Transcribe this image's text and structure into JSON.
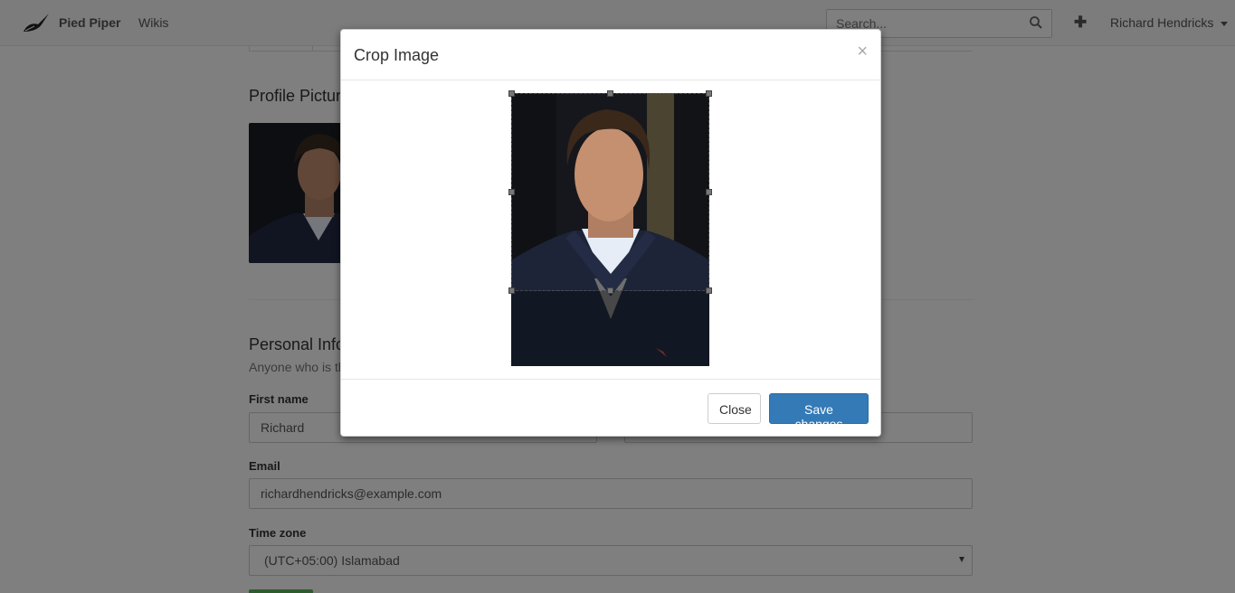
{
  "navbar": {
    "brand": "Pied Piper",
    "wikis": "Wikis",
    "search_placeholder": "Search...",
    "user_name": "Richard Hendricks"
  },
  "profile": {
    "picture_heading": "Profile Picture",
    "personal_heading": "Personal Information",
    "personal_sub": "Anyone who is th"
  },
  "form": {
    "first_name_label": "First name",
    "first_name_value": "Richard",
    "last_name_value": "",
    "email_label": "Email",
    "email_value": "richardhendricks@example.com",
    "timezone_label": "Time zone",
    "timezone_value": "(UTC+05:00) Islamabad"
  },
  "modal": {
    "title": "Crop Image",
    "close_symbol": "×",
    "close_button": "Close",
    "save_button": "Save changes"
  },
  "colors": {
    "primary": "#337ab7",
    "success": "#5cb85c",
    "navbar_bg": "#f8f8f8"
  }
}
